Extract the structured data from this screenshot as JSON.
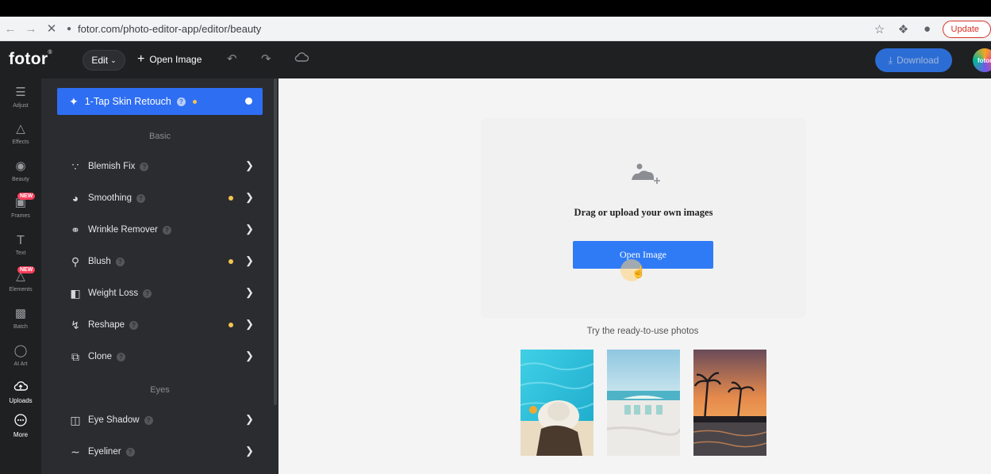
{
  "browser": {
    "url": "fotor.com/photo-editor-app/editor/beauty",
    "update_label": "Update"
  },
  "header": {
    "logo": "fotor",
    "edit_label": "Edit",
    "open_image_label": "Open Image",
    "download_label": "Download",
    "avatar_text": "fotor"
  },
  "rail": {
    "items": [
      {
        "label": "Adjust",
        "icon": "sliders-icon"
      },
      {
        "label": "Effects",
        "icon": "flask-icon"
      },
      {
        "label": "Beauty",
        "icon": "eye-icon"
      },
      {
        "label": "Frames",
        "icon": "frame-icon",
        "badge": "NEW"
      },
      {
        "label": "Text",
        "icon": "text-icon"
      },
      {
        "label": "Elements",
        "icon": "shapes-icon",
        "badge": "NEW"
      },
      {
        "label": "Batch",
        "icon": "batch-icon"
      },
      {
        "label": "AI Art",
        "icon": "ai-icon"
      },
      {
        "label": "Uploads",
        "icon": "cloud-upload-icon"
      },
      {
        "label": "More",
        "icon": "more-icon"
      }
    ]
  },
  "panel": {
    "retouch_label": "1-Tap Skin Retouch",
    "basic_heading": "Basic",
    "eyes_heading": "Eyes",
    "basic_tools": [
      {
        "label": "Blemish Fix",
        "icon": "blemish-icon"
      },
      {
        "label": "Smoothing",
        "icon": "smoothing-icon"
      },
      {
        "label": "Wrinkle Remover",
        "icon": "wrinkle-icon"
      },
      {
        "label": "Blush",
        "icon": "blush-icon"
      },
      {
        "label": "Weight Loss",
        "icon": "weight-loss-icon"
      },
      {
        "label": "Reshape",
        "icon": "reshape-icon"
      },
      {
        "label": "Clone",
        "icon": "clone-icon"
      }
    ],
    "eye_tools": [
      {
        "label": "Eye Shadow",
        "icon": "eye-shadow-icon"
      },
      {
        "label": "Eyeliner",
        "icon": "eyeliner-icon"
      }
    ]
  },
  "main": {
    "drag_text": "Drag or upload your own images",
    "open_button": "Open Image",
    "try_text": "Try the ready-to-use photos"
  },
  "colors": {
    "accent": "#2f7bf5",
    "dark_bg": "#1f2022",
    "panel_bg": "#2b2c2f",
    "badge": "#ff3d5b",
    "dot": "#f5c451"
  }
}
